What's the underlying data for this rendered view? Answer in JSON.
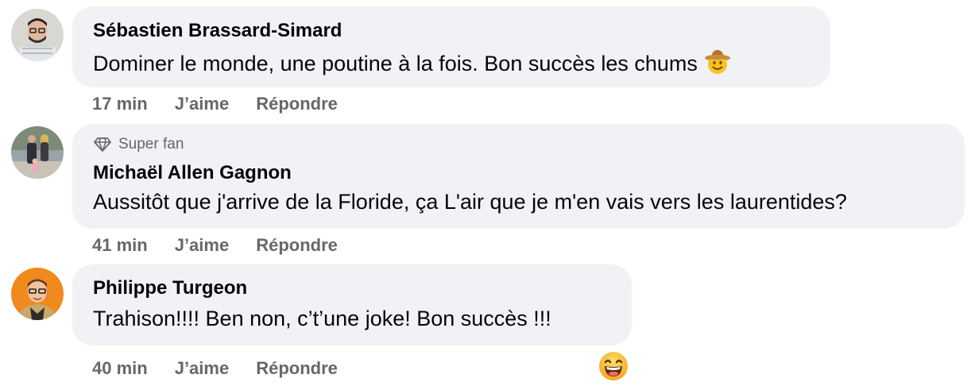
{
  "comments": [
    {
      "author": "Sébastien Brassard-Simard",
      "text": "Dominer le monde, une poutine à la fois. Bon succès les chums",
      "text_emoji": "cowboy-hat-face-emoji",
      "time": "17 min",
      "like_label": "J’aime",
      "reply_label": "Répondre"
    },
    {
      "badge": "Super fan",
      "badge_icon": "diamond-icon",
      "author": "Michaël Allen Gagnon",
      "text": "Aussitôt que j'arrive de la Floride, ça L'air que je m'en vais vers les laurentides?",
      "time": "41 min",
      "like_label": "J’aime",
      "reply_label": "Répondre"
    },
    {
      "author": "Philippe Turgeon",
      "text": "Trahison!!!! Ben non, c’t’une joke! Bon succès !!!",
      "time": "40 min",
      "like_label": "J’aime",
      "reply_label": "Répondre",
      "reaction": "laughing-face-emoji"
    }
  ],
  "colors": {
    "bubble": "#f0f2f5",
    "secondary_text": "#65676b",
    "primary_text": "#050505",
    "avatar3_bg": "#f0891e"
  }
}
